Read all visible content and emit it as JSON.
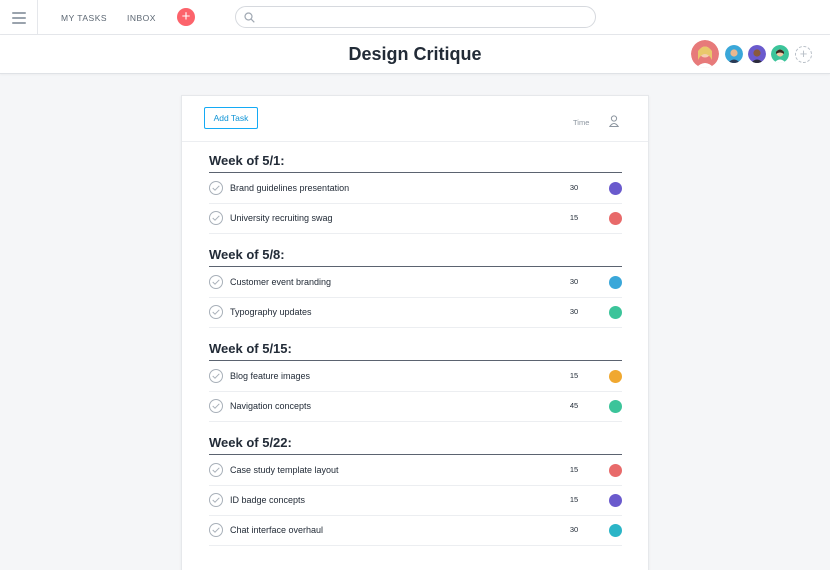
{
  "nav": {
    "my_tasks": "MY TASKS",
    "inbox": "INBOX",
    "quick_add": "+"
  },
  "search": {
    "placeholder": ""
  },
  "project": {
    "title": "Design Critique",
    "add_member": "+"
  },
  "list": {
    "add_task_label": "Add Task",
    "time_header": "Time",
    "sections": [
      {
        "title": "Week of 5/1:",
        "tasks": [
          {
            "name": "Brand guidelines presentation",
            "time": "30",
            "avatar": "purple"
          },
          {
            "name": "University recruiting swag",
            "time": "15",
            "avatar": "red"
          }
        ]
      },
      {
        "title": "Week of 5/8:",
        "tasks": [
          {
            "name": "Customer event branding",
            "time": "30",
            "avatar": "blue"
          },
          {
            "name": "Typography updates",
            "time": "30",
            "avatar": "green"
          }
        ]
      },
      {
        "title": "Week of 5/15:",
        "tasks": [
          {
            "name": "Blog feature images",
            "time": "15",
            "avatar": "orange"
          },
          {
            "name": "Navigation concepts",
            "time": "45",
            "avatar": "green"
          }
        ]
      },
      {
        "title": "Week of 5/22:",
        "tasks": [
          {
            "name": "Case study template layout",
            "time": "15",
            "avatar": "red"
          },
          {
            "name": "ID badge concepts",
            "time": "15",
            "avatar": "purple"
          },
          {
            "name": "Chat interface overhaul",
            "time": "30",
            "avatar": "teal"
          }
        ]
      }
    ]
  },
  "colors": {
    "accent": "#14aaf5",
    "quick_add": "#fc636b",
    "avatar_purple": "#6a5acd",
    "avatar_red": "#e86a6a",
    "avatar_blue": "#3aa7d9",
    "avatar_green": "#3cc49a",
    "avatar_orange": "#f0a830",
    "avatar_teal": "#2bb5c7"
  },
  "icons": [
    "menu-icon",
    "plus-icon",
    "search-icon",
    "checkmark-icon",
    "assignee-icon"
  ]
}
